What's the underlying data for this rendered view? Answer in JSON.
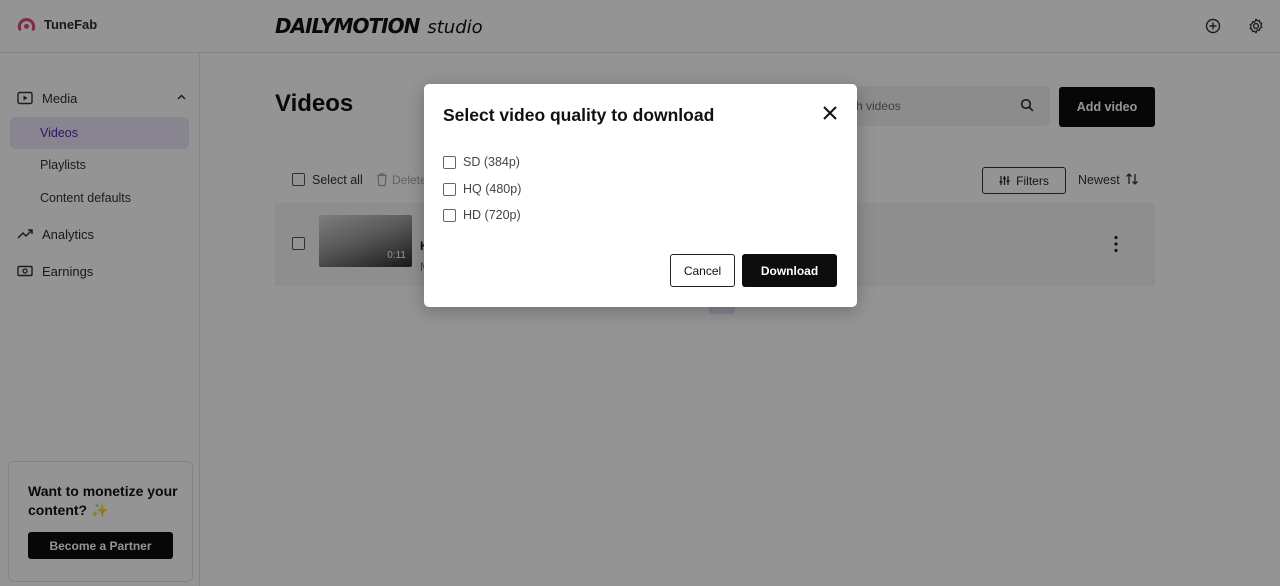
{
  "app": {
    "name": "TuneFab"
  },
  "header": {
    "logo_word": "DAILYMOTION",
    "logo_suffix": "studio"
  },
  "sidebar": {
    "media_label": "Media",
    "sub_items": [
      "Videos",
      "Playlists",
      "Content defaults"
    ],
    "analytics_label": "Analytics",
    "earnings_label": "Earnings",
    "promo": {
      "text": "Want to monetize your content? ✨",
      "button": "Become a Partner"
    }
  },
  "main": {
    "title": "Videos",
    "search_placeholder": "ch videos",
    "add_video": "Add video",
    "select_all": "Select all",
    "delete": "Delete",
    "filters": "Filters",
    "sort": "Newest",
    "video": {
      "duration": "0:11"
    }
  },
  "modal": {
    "title": "Select video quality to download",
    "options": [
      "SD (384p)",
      "HQ (480p)",
      "HD (720p)"
    ],
    "cancel": "Cancel",
    "download": "Download"
  },
  "colors": {
    "accent": "#4a2fb0",
    "active_bg": "#ebe3f8",
    "brand_pink": "#d94b7a",
    "button_dark": "#0d0d0d"
  }
}
